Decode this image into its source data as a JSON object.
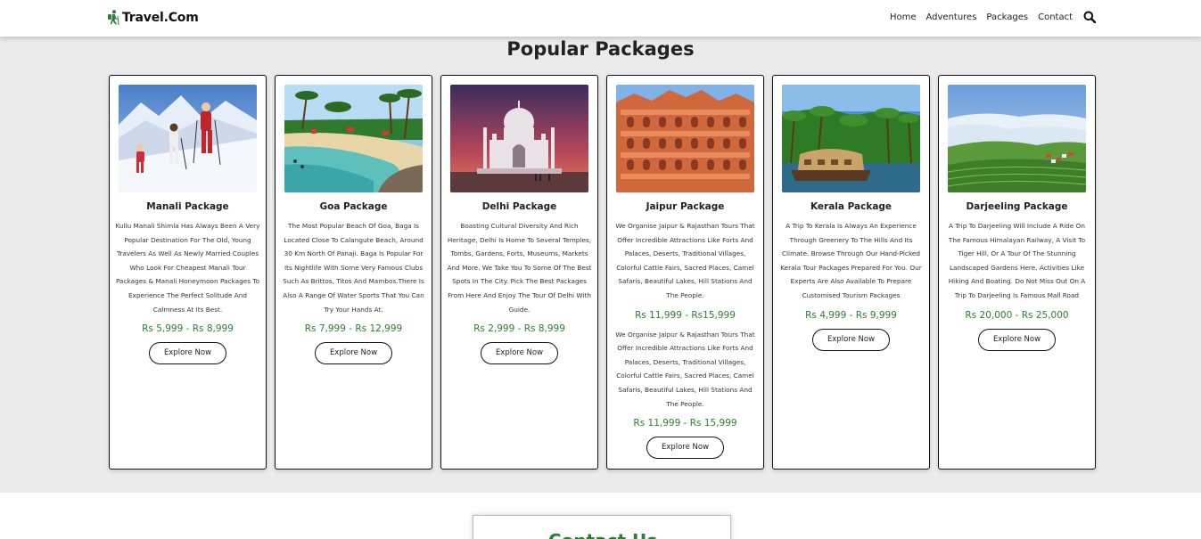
{
  "brand": {
    "name": "Travel.Com",
    "color": "#2e7d32"
  },
  "nav": {
    "links": [
      "Home",
      "Adventures",
      "Packages",
      "Contact"
    ],
    "search_icon": "search-icon"
  },
  "packages": {
    "title": "Popular Packages",
    "price_color": "#2e7d32",
    "cards": [
      {
        "image": "skiers-on-snowy-mountain",
        "title": "Manali Package",
        "desc": "Kullu Manali Shimla Has Always Been A Very Popular Destination For The Old, Young Travelers As Well As Newly Married Couples Who Look For Cheapest Manali Tour Packages & Manali Honeymoon Packages To Experience The Perfect Solitude And Calmness At Its Best.",
        "price": "Rs 5,999 - Rs 8,999",
        "button": "Explore Now"
      },
      {
        "image": "goa-beach-with-palms",
        "title": "Goa Package",
        "desc": "The Most Popular Beach Of Goa, Baga Is Located Close To Calangute Beach, Around 30 Km North Of Panaji. Baga Is Popular For Its Nightlife With Some Very Famous Clubs Such As Brittos, Titos And Mambos.There Is Also A Range Of Water Sports That You Can Try Your Hands At.",
        "price": "Rs 7,999 - Rs 12,999",
        "button": "Explore Now"
      },
      {
        "image": "taj-mahal-at-dusk",
        "title": "Delhi Package",
        "desc": "Boasting Cultural Diversity And Rich Heritage, Delhi Is Home To Several Temples, Tombs, Gardens, Forts, Museums, Markets And More. We Take You To Some Of The Best Spots In The City. Pick The Best Packages From Here And Enjoy The Tour Of Delhi With Guide.",
        "price": "Rs 2,999 - Rs 8,999",
        "button": "Explore Now"
      },
      {
        "image": "hawa-mahal-jaipur",
        "title": "Jaipur Package",
        "desc": "We Organise Jaipur & Rajasthan Tours That Offer Incredible Attractions Like Forts And Palaces, Deserts, Traditional Villages, Colorful Cattle Fairs, Sacred Places, Camel Safaris, Beautiful Lakes, Hill Stations And The People.",
        "price": "Rs 11,999 - Rs15,999",
        "desc2": "We Organise Jaipur & Rajasthan Tours That Offer Incredible Attractions Like Forts And Palaces, Deserts, Traditional Villages, Colorful Cattle Fairs, Sacred Places, Camel Safaris, Beautiful Lakes, Hill Stations And The People.",
        "price2": "Rs 11,999 - Rs 15,999",
        "button": "Explore Now"
      },
      {
        "image": "kerala-houseboat-backwaters",
        "title": "Kerala Package",
        "desc": "A Trip To Kerala Is Always An Experience Through Greenery To The Hills And Its Climate. Browse Through Our Hand-Picked Kerala Tour Packages Prepared For You. Our Experts Are Also Available To Prepare Customised Tourism Packages",
        "price": "Rs 4,999 - Rs 9,999",
        "button": "Explore Now"
      },
      {
        "image": "darjeeling-hills-and-clouds",
        "title": "Darjeeling Package",
        "desc": "A Trip To Darjeeling Will Include A Ride On The Famous Himalayan Railway, A Visit To Tiger Hill, Or A Tour Of The Stunning Landscaped Gardens Here. Activities Like Hiking And Boating. Do Not Miss Out On A Trip To Darjeeling Is Famous Mall Road",
        "price": "Rs 20,000 - Rs 25,000",
        "button": "Explore Now"
      }
    ]
  },
  "contact": {
    "title": "Contact Us"
  }
}
